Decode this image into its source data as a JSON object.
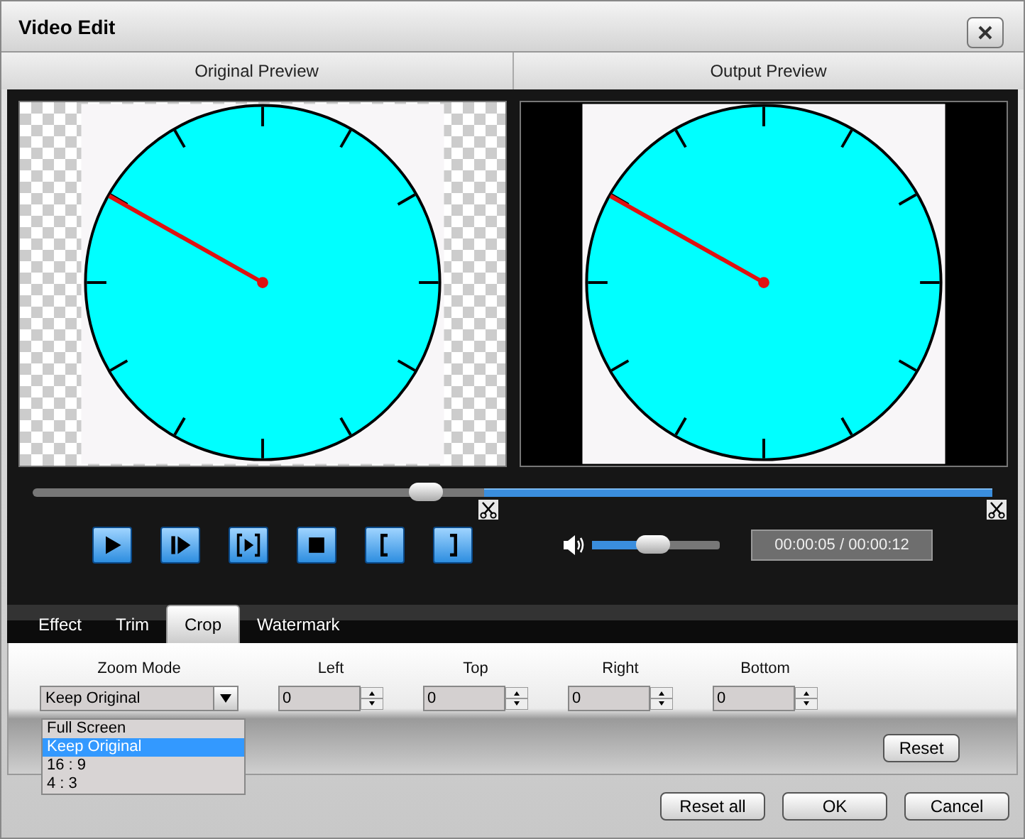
{
  "window": {
    "title": "Video Edit"
  },
  "preview_headers": [
    "Original Preview",
    "Output Preview"
  ],
  "previews": [
    {
      "kind": "original"
    },
    {
      "kind": "output"
    }
  ],
  "timeline": {
    "level": 0.41,
    "selection": {
      "level": 0.53
    }
  },
  "transport_buttons": [
    {
      "kind": "play"
    },
    {
      "kind": "step"
    },
    {
      "kind": "frame"
    },
    {
      "kind": "stop"
    },
    {
      "kind": "mark_in"
    },
    {
      "kind": "mark_out"
    }
  ],
  "volume": {
    "level": 0.48
  },
  "time": "00:00:05 / 00:00:12",
  "tabs": [
    {
      "label": "Effect",
      "selected": false
    },
    {
      "label": "Trim",
      "selected": false
    },
    {
      "label": "Crop",
      "selected": true
    },
    {
      "label": "Watermark",
      "selected": false
    }
  ],
  "crop": {
    "zoom_mode": {
      "label": "Zoom Mode",
      "value": "Keep Original",
      "expanded": true,
      "options": [
        {
          "label": "Full Screen",
          "selected": false
        },
        {
          "label": "Keep Original",
          "selected": true
        },
        {
          "label": "16 : 9",
          "selected": false
        },
        {
          "label": "4 : 3",
          "selected": false
        }
      ]
    },
    "fields": [
      {
        "label": "Left",
        "value": "0"
      },
      {
        "label": "Top",
        "value": "0"
      },
      {
        "label": "Right",
        "value": "0"
      },
      {
        "label": "Bottom",
        "value": "0"
      }
    ],
    "reset_button": "Reset"
  },
  "footer_buttons": [
    "Reset all",
    "OK",
    "Cancel"
  ]
}
